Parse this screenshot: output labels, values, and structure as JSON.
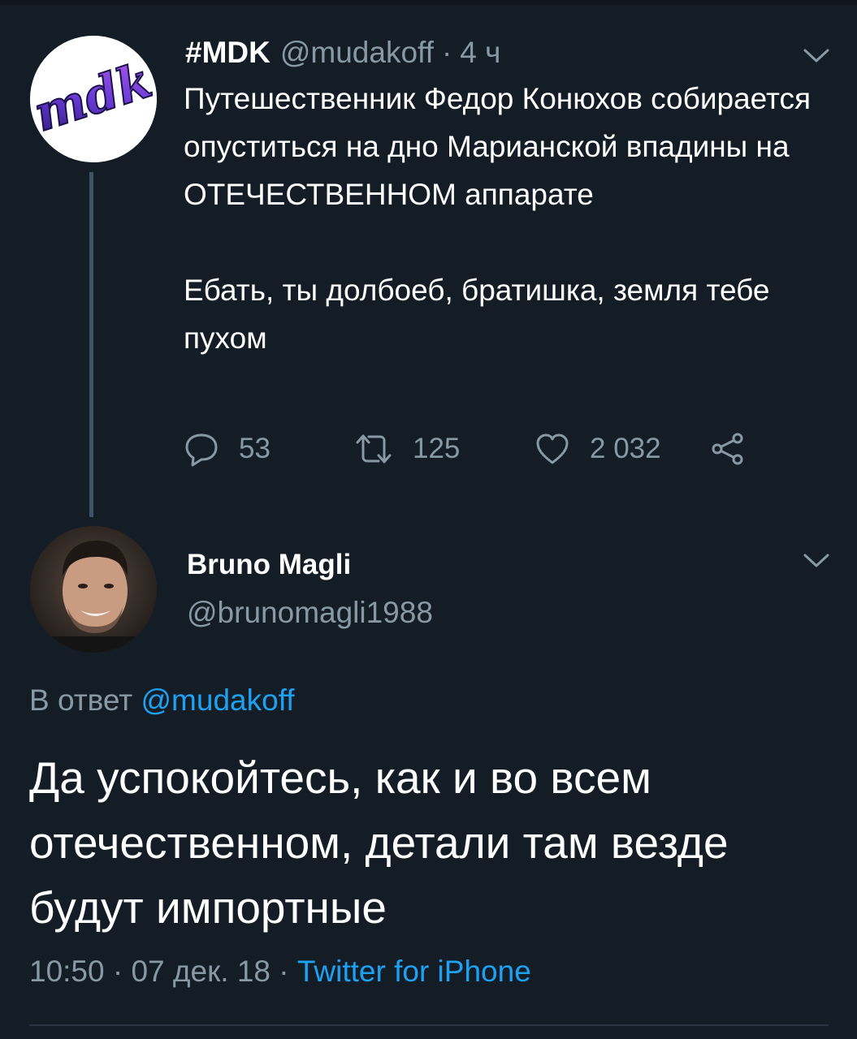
{
  "tweet": {
    "display_name": "#MDK",
    "handle": "@mudakoff",
    "separator": "·",
    "time": "4 ч",
    "avatar_text": "mdk",
    "text_paragraph_1": "Путешественник Федор Конюхов собирается опуститься на дно Марианской впадины на ОТЕЧЕСТВЕННОМ аппарате",
    "text_paragraph_2": "Ебать, ты долбоеб, братишка, земля тебе пухом",
    "replies": "53",
    "retweets": "125",
    "likes": "2 032"
  },
  "reply": {
    "display_name": "Bruno Magli",
    "handle": "@brunomagli1988",
    "reply_prefix": "В ответ",
    "reply_to": "@mudakoff",
    "text": "Да успокойтесь, как и во всем отечественном, детали там везде будут импортные",
    "timestamp": "10:50 · 07 дек. 18 ·",
    "source": "Twitter for iPhone"
  },
  "colors": {
    "background": "#141d26",
    "secondary_text": "#8899a6",
    "link": "#1da1f2",
    "thread_line": "#3d5466"
  },
  "icons": [
    "chevron-down-icon",
    "reply-icon",
    "retweet-icon",
    "like-icon",
    "share-icon"
  ]
}
